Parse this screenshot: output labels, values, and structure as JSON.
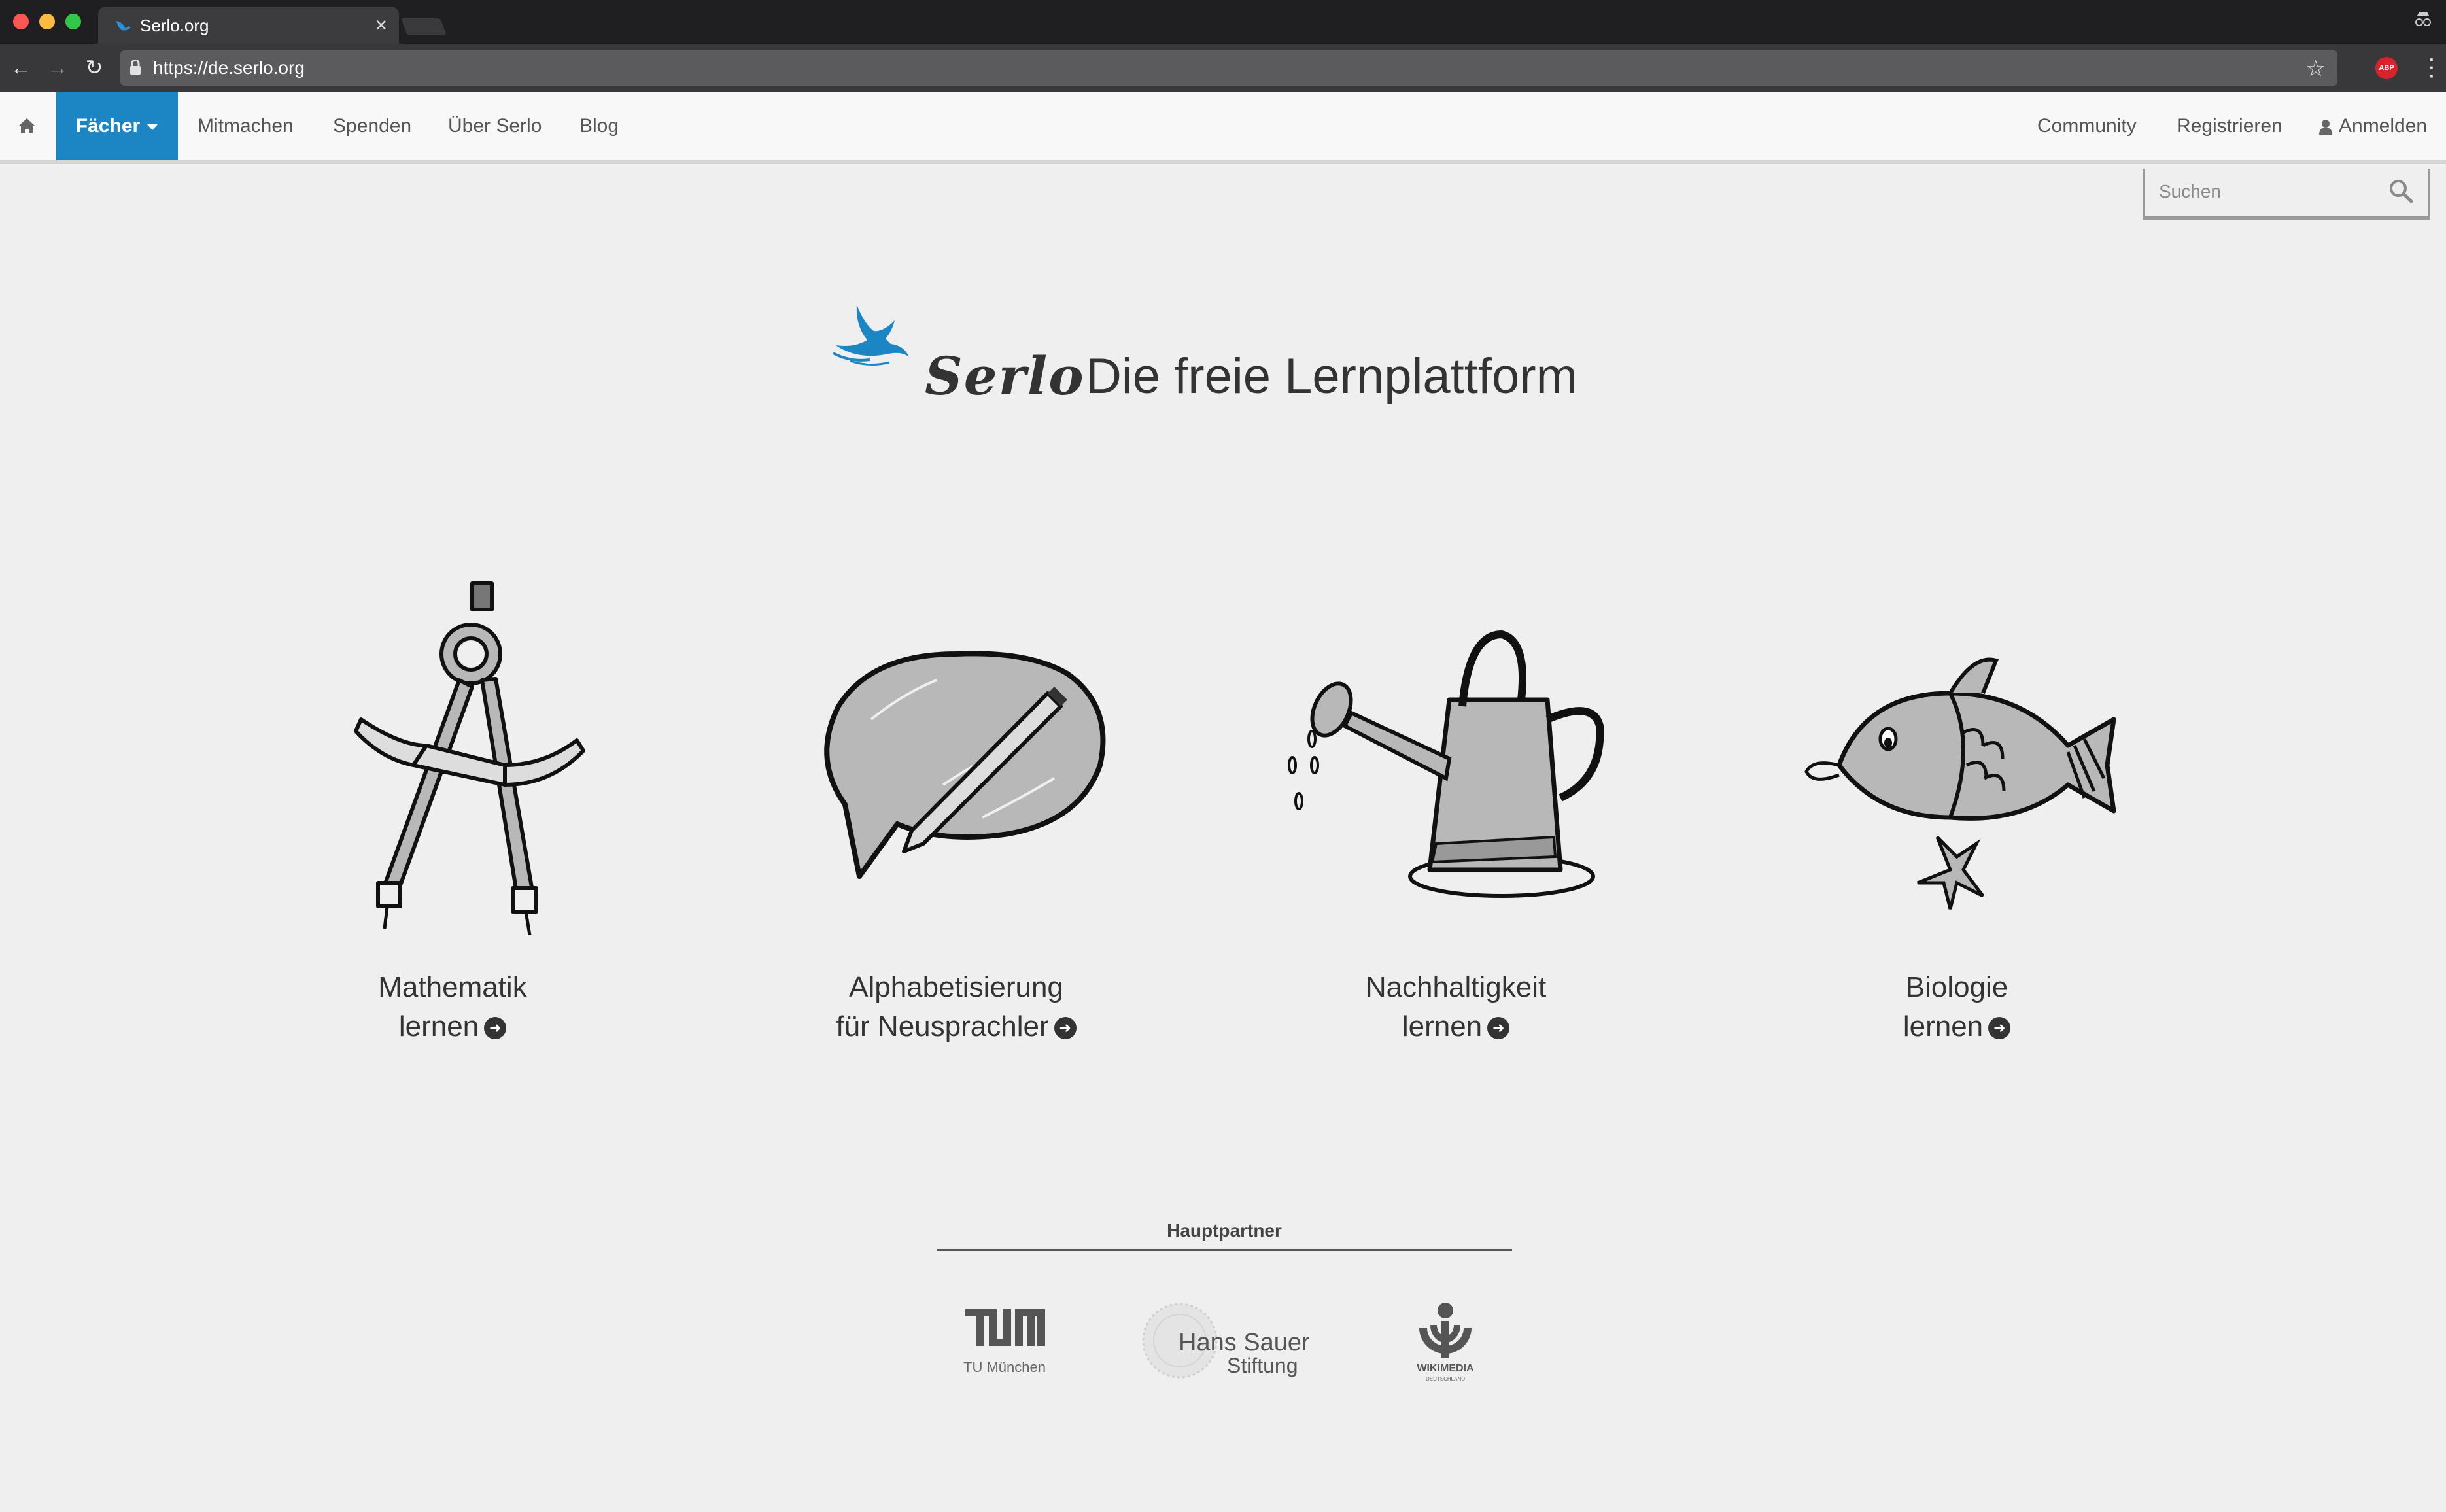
{
  "browser": {
    "tab_title": "Serlo.org",
    "tab_close": "×",
    "url": "https://de.serlo.org",
    "abp_label": "ABP"
  },
  "nav": {
    "faecher": "Fächer",
    "mitmachen": "Mitmachen",
    "spenden": "Spenden",
    "ueber": "Über Serlo",
    "blog": "Blog",
    "community": "Community",
    "registrieren": "Registrieren",
    "anmelden": "Anmelden"
  },
  "search": {
    "placeholder": "Suchen"
  },
  "hero": {
    "logo": "Serlo",
    "tagline": "Die freie Lernplattform"
  },
  "subjects": [
    {
      "line1": "Mathematik",
      "line2": "lernen",
      "icon": "compass-icon"
    },
    {
      "line1": "Alphabetisierung",
      "line2": "für Neusprachler",
      "icon": "speech-pencil-icon"
    },
    {
      "line1": "Nachhaltigkeit",
      "line2": "lernen",
      "icon": "watering-can-icon"
    },
    {
      "line1": "Biologie",
      "line2": "lernen",
      "icon": "fish-icon"
    }
  ],
  "partners": {
    "title": "Hauptpartner",
    "tum_caption": "TU München",
    "hans_line1": "Hans Sauer",
    "hans_line2": "Stiftung",
    "wiki_caption": "WIKIMEDIA",
    "wiki_sub": "DEUTSCHLAND"
  },
  "colors": {
    "accent": "#1c85c3",
    "text": "#333333",
    "background": "#efefef"
  }
}
